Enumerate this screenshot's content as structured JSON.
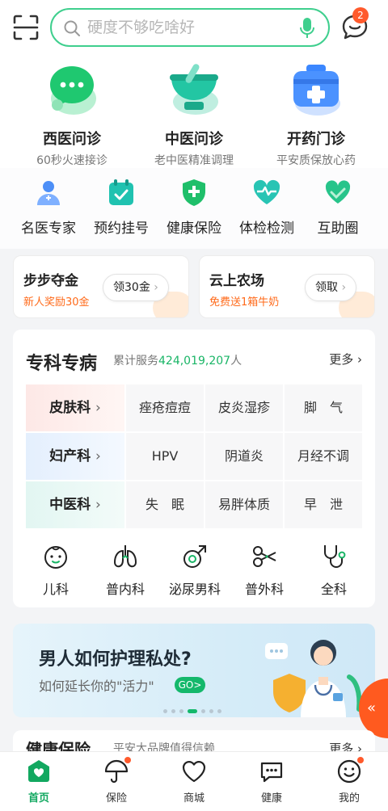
{
  "header": {
    "search_placeholder": "硬度不够吃啥好",
    "message_badge": "2"
  },
  "services": [
    {
      "title": "西医问诊",
      "subtitle": "60秒火速接诊",
      "icon": "chat-bubble-icon"
    },
    {
      "title": "中医问诊",
      "subtitle": "老中医精准调理",
      "icon": "mortar-pestle-icon"
    },
    {
      "title": "开药门诊",
      "subtitle": "平安质保放心药",
      "icon": "medicine-kit-icon"
    }
  ],
  "quick_grid": [
    {
      "label": "名医专家",
      "icon": "doctor-icon"
    },
    {
      "label": "预约挂号",
      "icon": "calendar-check-icon"
    },
    {
      "label": "健康保险",
      "icon": "shield-plus-icon"
    },
    {
      "label": "体检检测",
      "icon": "heart-pulse-icon"
    },
    {
      "label": "互助圈",
      "icon": "heart-hands-icon"
    }
  ],
  "promo_cards": [
    {
      "title": "步步夺金",
      "subtitle": "新人奖励30金",
      "button": "领30金"
    },
    {
      "title": "云上农场",
      "subtitle": "免费送1箱牛奶",
      "button": "领取"
    }
  ],
  "specialty": {
    "title": "专科专病",
    "count_prefix": "累计服务",
    "count_value": "424,019,207",
    "count_suffix": "人",
    "more": "更多",
    "rows": [
      {
        "category": "皮肤科",
        "items": [
          "痤疮痘痘",
          "皮炎湿疹",
          "脚　气"
        ]
      },
      {
        "category": "妇产科",
        "items": [
          "HPV",
          "阴道炎",
          "月经不调"
        ]
      },
      {
        "category": "中医科",
        "items": [
          "失　眠",
          "易胖体质",
          "早　泄"
        ]
      }
    ],
    "departments": [
      {
        "label": "儿科",
        "icon": "baby-face-icon"
      },
      {
        "label": "普内科",
        "icon": "lungs-icon"
      },
      {
        "label": "泌尿男科",
        "icon": "male-symbol-icon"
      },
      {
        "label": "普外科",
        "icon": "scissors-icon"
      },
      {
        "label": "全科",
        "icon": "stethoscope-icon"
      }
    ]
  },
  "banner": {
    "title": "男人如何护理私处?",
    "subtitle": "如何延长你的\"活力\"",
    "go": "GO>"
  },
  "insurance_peek": {
    "title": "健康保险",
    "subtitle": "平安大品牌值得信赖",
    "more": "更多"
  },
  "tabs": [
    {
      "label": "首页",
      "icon": "home-heart-icon",
      "active": true
    },
    {
      "label": "保险",
      "icon": "umbrella-icon",
      "active": false
    },
    {
      "label": "商城",
      "icon": "heart-outline-icon",
      "active": false
    },
    {
      "label": "健康",
      "icon": "chat-dots-icon",
      "active": false
    },
    {
      "label": "我的",
      "icon": "smiley-icon",
      "active": false
    }
  ],
  "colors": {
    "brand_green": "#19b566",
    "accent_orange": "#ff5a2c"
  }
}
